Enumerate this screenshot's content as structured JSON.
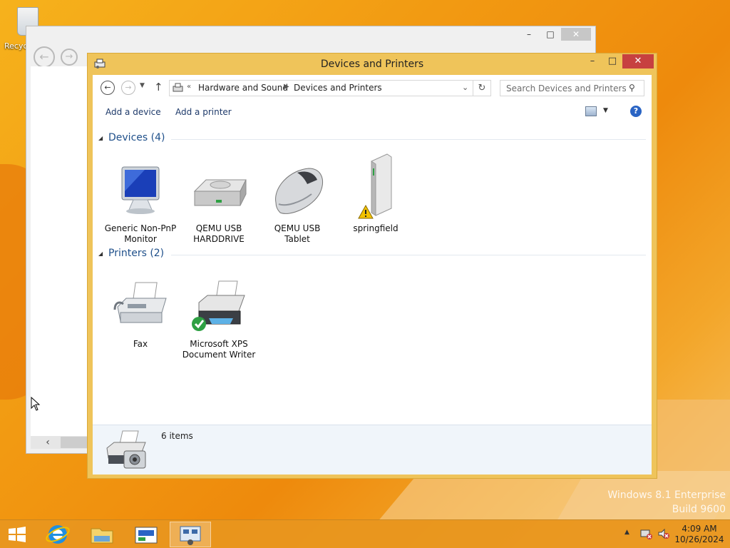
{
  "desktop": {
    "recycle_bin_label": "Recyc",
    "watermark_line1": "Windows 8.1 Enterprise",
    "watermark_line2": "Build 9600"
  },
  "window": {
    "title": "Devices and Printers",
    "controls": {
      "minimize": "–",
      "maximize": "□",
      "close": "✕"
    }
  },
  "navigation": {
    "back": "←",
    "forward": "→",
    "up": "↑",
    "address": {
      "prefix": "«",
      "segments": [
        "Hardware and Sound",
        "Devices and Printers"
      ]
    },
    "refresh": "↻",
    "search_placeholder": "Search Devices and Printers"
  },
  "commands": {
    "add_device": "Add a device",
    "add_printer": "Add a printer",
    "help": "?"
  },
  "groups": {
    "devices": {
      "title": "Devices (4)",
      "items": [
        {
          "label": "Generic Non-PnP\nMonitor",
          "icon": "monitor-icon"
        },
        {
          "label": "QEMU USB\nHARDDRIVE",
          "icon": "harddrive-icon"
        },
        {
          "label": "QEMU USB\nTablet",
          "icon": "mouse-icon"
        },
        {
          "label": "springfield",
          "icon": "computer-tower-icon",
          "warning": true
        }
      ]
    },
    "printers": {
      "title": "Printers (2)",
      "items": [
        {
          "label": "Fax",
          "icon": "fax-icon"
        },
        {
          "label": "Microsoft XPS\nDocument Writer",
          "icon": "printer-icon",
          "default": true
        }
      ]
    }
  },
  "details": {
    "count_text": "6 items"
  },
  "taskbar": {
    "items": [
      "internet-explorer-icon",
      "file-explorer-icon",
      "control-panel-icon",
      "devices-and-printers-icon"
    ],
    "time": "4:09 AM",
    "date": "10/26/2024"
  }
}
